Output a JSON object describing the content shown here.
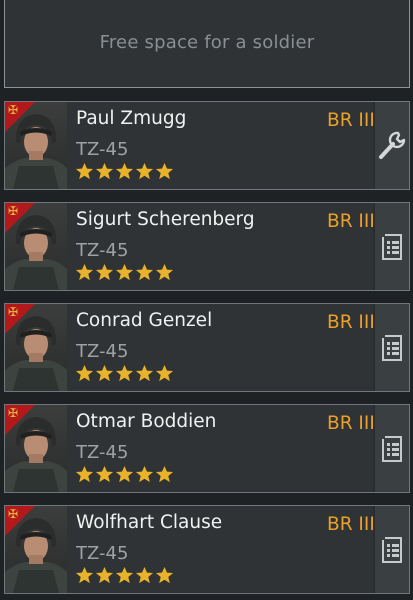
{
  "free_slot": {
    "label": "Free space for a soldier"
  },
  "soldiers": [
    {
      "name": "Paul Zmugg",
      "br": "BR III",
      "weapon": "TZ-45",
      "stars": 5,
      "action_icon": "wrench-icon"
    },
    {
      "name": "Sigurt Scherenberg",
      "br": "BR III",
      "weapon": "TZ-45",
      "stars": 5,
      "action_icon": "list-icon"
    },
    {
      "name": "Conrad Genzel",
      "br": "BR III",
      "weapon": "TZ-45",
      "stars": 5,
      "action_icon": "list-icon"
    },
    {
      "name": "Otmar Boddien",
      "br": "BR III",
      "weapon": "TZ-45",
      "stars": 5,
      "action_icon": "list-icon"
    },
    {
      "name": "Wolfhart Clause",
      "br": "BR III",
      "weapon": "TZ-45",
      "stars": 5,
      "action_icon": "list-icon"
    }
  ],
  "colors": {
    "br": "#eba027",
    "star": "#e8b32a",
    "rank_flag": "#b3191a",
    "card_bg": "#2f3336",
    "card_border": "#70767b"
  }
}
